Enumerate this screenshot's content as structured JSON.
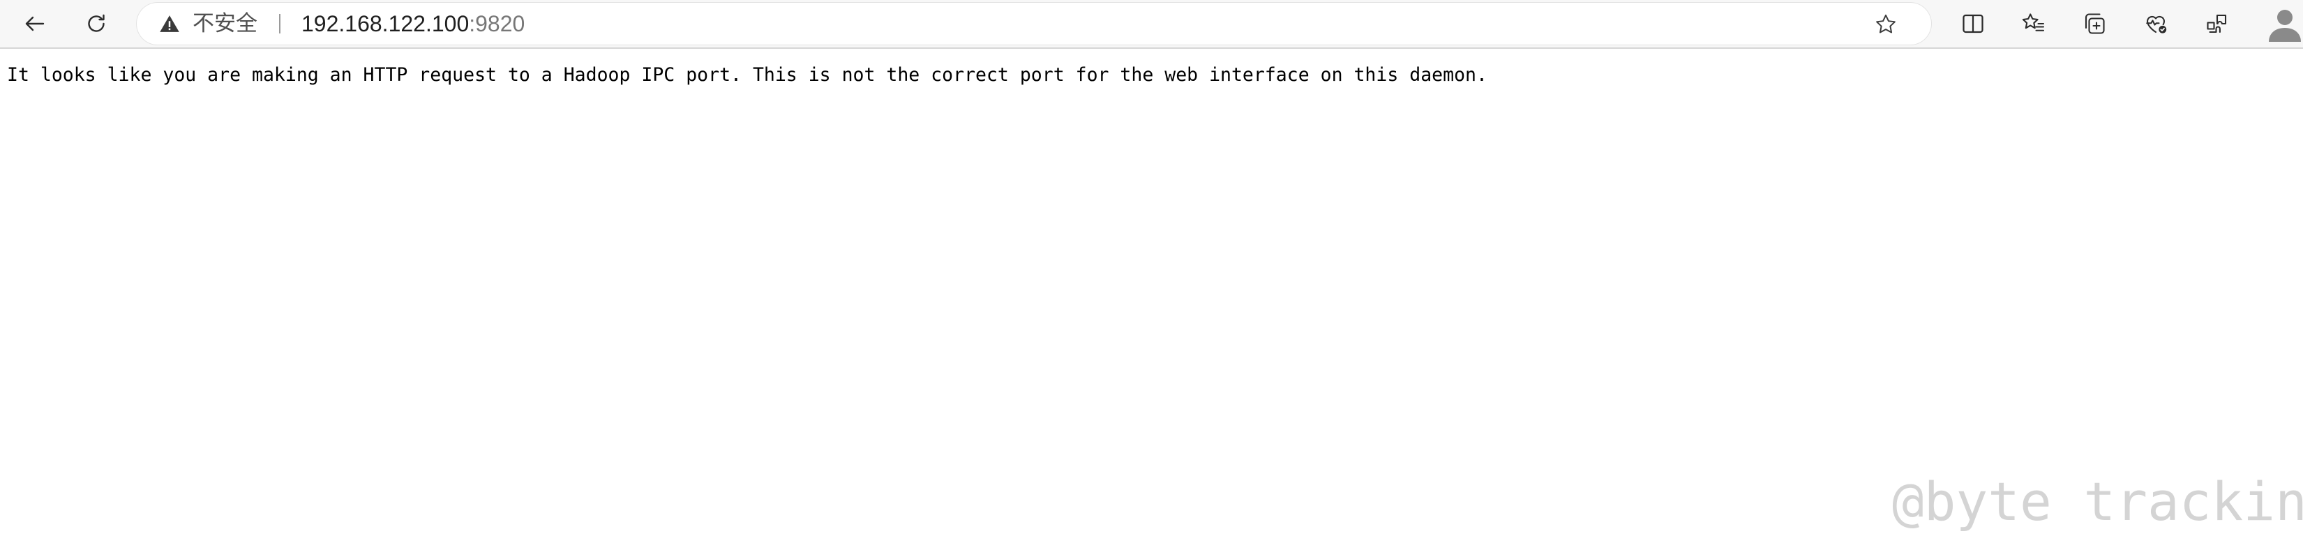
{
  "addressbar": {
    "security_label": "不安全",
    "url_host": "192.168.122.100",
    "url_port": ":9820"
  },
  "icons": {
    "back": "back-arrow-icon",
    "reload": "reload-icon",
    "warning": "warning-triangle-icon",
    "favorite": "star-icon",
    "split_screen": "split-screen-icon",
    "favorites": "favorites-icon",
    "collections": "collections-icon",
    "browser_essentials": "heart-pulse-icon",
    "extensions": "extensions-icon",
    "profile": "avatar-icon"
  },
  "page": {
    "message": "It looks like you are making an HTTP request to a Hadoop IPC port. This is not the correct port for the web interface on this daemon."
  },
  "watermark": "@byte tracking",
  "colors": {
    "toolbar_bg": "#f7f7f7",
    "url_host": "#1f1f1f",
    "url_port": "#777777",
    "watermark": "#d4d4d4"
  }
}
